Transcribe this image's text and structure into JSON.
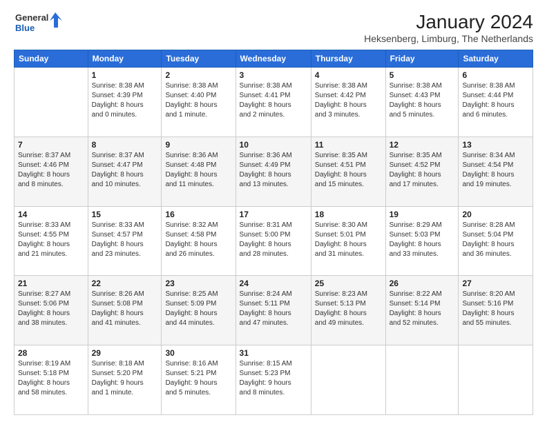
{
  "header": {
    "logo": {
      "general": "General",
      "blue": "Blue"
    },
    "title": "January 2024",
    "subtitle": "Heksenberg, Limburg, The Netherlands"
  },
  "calendar": {
    "days": [
      "Sunday",
      "Monday",
      "Tuesday",
      "Wednesday",
      "Thursday",
      "Friday",
      "Saturday"
    ],
    "weeks": [
      [
        {
          "day": "",
          "content": ""
        },
        {
          "day": "1",
          "content": "Sunrise: 8:38 AM\nSunset: 4:39 PM\nDaylight: 8 hours\nand 0 minutes."
        },
        {
          "day": "2",
          "content": "Sunrise: 8:38 AM\nSunset: 4:40 PM\nDaylight: 8 hours\nand 1 minute."
        },
        {
          "day": "3",
          "content": "Sunrise: 8:38 AM\nSunset: 4:41 PM\nDaylight: 8 hours\nand 2 minutes."
        },
        {
          "day": "4",
          "content": "Sunrise: 8:38 AM\nSunset: 4:42 PM\nDaylight: 8 hours\nand 3 minutes."
        },
        {
          "day": "5",
          "content": "Sunrise: 8:38 AM\nSunset: 4:43 PM\nDaylight: 8 hours\nand 5 minutes."
        },
        {
          "day": "6",
          "content": "Sunrise: 8:38 AM\nSunset: 4:44 PM\nDaylight: 8 hours\nand 6 minutes."
        }
      ],
      [
        {
          "day": "7",
          "content": "Sunrise: 8:37 AM\nSunset: 4:46 PM\nDaylight: 8 hours\nand 8 minutes."
        },
        {
          "day": "8",
          "content": "Sunrise: 8:37 AM\nSunset: 4:47 PM\nDaylight: 8 hours\nand 10 minutes."
        },
        {
          "day": "9",
          "content": "Sunrise: 8:36 AM\nSunset: 4:48 PM\nDaylight: 8 hours\nand 11 minutes."
        },
        {
          "day": "10",
          "content": "Sunrise: 8:36 AM\nSunset: 4:49 PM\nDaylight: 8 hours\nand 13 minutes."
        },
        {
          "day": "11",
          "content": "Sunrise: 8:35 AM\nSunset: 4:51 PM\nDaylight: 8 hours\nand 15 minutes."
        },
        {
          "day": "12",
          "content": "Sunrise: 8:35 AM\nSunset: 4:52 PM\nDaylight: 8 hours\nand 17 minutes."
        },
        {
          "day": "13",
          "content": "Sunrise: 8:34 AM\nSunset: 4:54 PM\nDaylight: 8 hours\nand 19 minutes."
        }
      ],
      [
        {
          "day": "14",
          "content": "Sunrise: 8:33 AM\nSunset: 4:55 PM\nDaylight: 8 hours\nand 21 minutes."
        },
        {
          "day": "15",
          "content": "Sunrise: 8:33 AM\nSunset: 4:57 PM\nDaylight: 8 hours\nand 23 minutes."
        },
        {
          "day": "16",
          "content": "Sunrise: 8:32 AM\nSunset: 4:58 PM\nDaylight: 8 hours\nand 26 minutes."
        },
        {
          "day": "17",
          "content": "Sunrise: 8:31 AM\nSunset: 5:00 PM\nDaylight: 8 hours\nand 28 minutes."
        },
        {
          "day": "18",
          "content": "Sunrise: 8:30 AM\nSunset: 5:01 PM\nDaylight: 8 hours\nand 31 minutes."
        },
        {
          "day": "19",
          "content": "Sunrise: 8:29 AM\nSunset: 5:03 PM\nDaylight: 8 hours\nand 33 minutes."
        },
        {
          "day": "20",
          "content": "Sunrise: 8:28 AM\nSunset: 5:04 PM\nDaylight: 8 hours\nand 36 minutes."
        }
      ],
      [
        {
          "day": "21",
          "content": "Sunrise: 8:27 AM\nSunset: 5:06 PM\nDaylight: 8 hours\nand 38 minutes."
        },
        {
          "day": "22",
          "content": "Sunrise: 8:26 AM\nSunset: 5:08 PM\nDaylight: 8 hours\nand 41 minutes."
        },
        {
          "day": "23",
          "content": "Sunrise: 8:25 AM\nSunset: 5:09 PM\nDaylight: 8 hours\nand 44 minutes."
        },
        {
          "day": "24",
          "content": "Sunrise: 8:24 AM\nSunset: 5:11 PM\nDaylight: 8 hours\nand 47 minutes."
        },
        {
          "day": "25",
          "content": "Sunrise: 8:23 AM\nSunset: 5:13 PM\nDaylight: 8 hours\nand 49 minutes."
        },
        {
          "day": "26",
          "content": "Sunrise: 8:22 AM\nSunset: 5:14 PM\nDaylight: 8 hours\nand 52 minutes."
        },
        {
          "day": "27",
          "content": "Sunrise: 8:20 AM\nSunset: 5:16 PM\nDaylight: 8 hours\nand 55 minutes."
        }
      ],
      [
        {
          "day": "28",
          "content": "Sunrise: 8:19 AM\nSunset: 5:18 PM\nDaylight: 8 hours\nand 58 minutes."
        },
        {
          "day": "29",
          "content": "Sunrise: 8:18 AM\nSunset: 5:20 PM\nDaylight: 9 hours\nand 1 minute."
        },
        {
          "day": "30",
          "content": "Sunrise: 8:16 AM\nSunset: 5:21 PM\nDaylight: 9 hours\nand 5 minutes."
        },
        {
          "day": "31",
          "content": "Sunrise: 8:15 AM\nSunset: 5:23 PM\nDaylight: 9 hours\nand 8 minutes."
        },
        {
          "day": "",
          "content": ""
        },
        {
          "day": "",
          "content": ""
        },
        {
          "day": "",
          "content": ""
        }
      ]
    ]
  }
}
